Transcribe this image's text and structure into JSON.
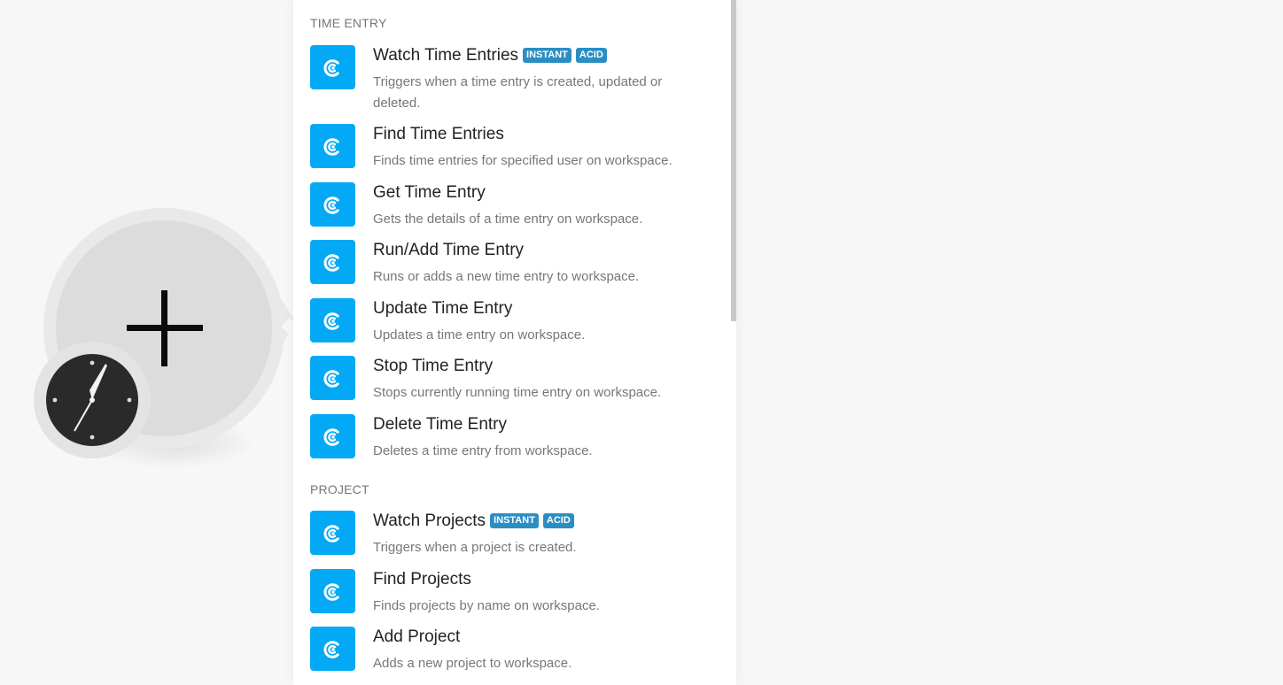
{
  "sections": [
    {
      "title": "TIME ENTRY",
      "items": [
        {
          "title": "Watch Time Entries",
          "badges": [
            "INSTANT",
            "ACID"
          ],
          "description": "Triggers when a time entry is created, updated or deleted."
        },
        {
          "title": "Find Time Entries",
          "badges": [],
          "description": "Finds time entries for specified user on workspace."
        },
        {
          "title": "Get Time Entry",
          "badges": [],
          "description": "Gets the details of a time entry on workspace."
        },
        {
          "title": "Run/Add Time Entry",
          "badges": [],
          "description": "Runs or adds a new time entry to workspace."
        },
        {
          "title": "Update Time Entry",
          "badges": [],
          "description": "Updates a time entry on workspace."
        },
        {
          "title": "Stop Time Entry",
          "badges": [],
          "description": "Stops currently running time entry on workspace."
        },
        {
          "title": "Delete Time Entry",
          "badges": [],
          "description": "Deletes a time entry from workspace."
        }
      ]
    },
    {
      "title": "PROJECT",
      "items": [
        {
          "title": "Watch Projects",
          "badges": [
            "INSTANT",
            "ACID"
          ],
          "description": "Triggers when a project is created."
        },
        {
          "title": "Find Projects",
          "badges": [],
          "description": "Finds projects by name on workspace."
        },
        {
          "title": "Add Project",
          "badges": [],
          "description": "Adds a new project to workspace."
        }
      ]
    }
  ],
  "icons": {
    "module": "plus-icon",
    "trigger": "clock-icon",
    "app": "clockify-icon"
  },
  "colors": {
    "app_icon_bg": "#03a9f4",
    "badge_bg": "#2b8ec3"
  }
}
